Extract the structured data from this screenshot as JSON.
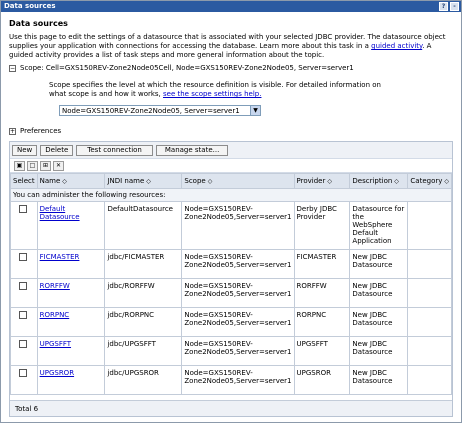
{
  "window": {
    "title": "Data sources",
    "buttons": [
      "?",
      "-"
    ]
  },
  "page": {
    "heading": "Data sources",
    "description": "Use this page to edit the settings of a datasource that is associated with your selected JDBC provider. The datasource object supplies your application with connections for accessing the database. Learn more about this task in a",
    "guided_link": "guided activity",
    "description_tail": ". A guided activity provides a list of task steps and more general information about the topic.",
    "scope_label": "Scope: Cell=GXS150REV-Zone2Node05Cell, Node=GXS150REV-Zone2Node05, Server=server1",
    "scope_desc": "Scope specifies the level at which the resource definition is visible. For detailed information on what scope is and how it works,",
    "scope_link": "see the scope settings help.",
    "scope_select": "Node=GXS150REV-Zone2Node05, Server=server1",
    "preferences": "Preferences"
  },
  "toolbar": {
    "new": "New",
    "delete": "Delete",
    "test": "Test connection",
    "manage": "Manage state..."
  },
  "table": {
    "headers": [
      "Select",
      "Name",
      "JNDI name",
      "Scope",
      "Provider",
      "Description",
      "Category"
    ],
    "admin_text": "You can administer the following resources:",
    "rows": [
      {
        "name": "Default Datasource",
        "jndi": "DefaultDatasource",
        "scope": "Node=GXS150REV-Zone2Node05,Server=server1",
        "provider": "Derby JDBC Provider",
        "description": "Datasource for the WebSphere Default Application",
        "category": ""
      },
      {
        "name": "FICMASTER",
        "jndi": "jdbc/FICMASTER",
        "scope": "Node=GXS150REV-Zone2Node05,Server=server1",
        "provider": "FICMASTER",
        "description": "New JDBC Datasource",
        "category": ""
      },
      {
        "name": "RORFFW",
        "jndi": "jdbc/RORFFW",
        "scope": "Node=GXS150REV-Zone2Node05,Server=server1",
        "provider": "RORFFW",
        "description": "New JDBC Datasource",
        "category": ""
      },
      {
        "name": "RORPNC",
        "jndi": "jdbc/RORPNC",
        "scope": "Node=GXS150REV-Zone2Node05,Server=server1",
        "provider": "RORPNC",
        "description": "New JDBC Datasource",
        "category": ""
      },
      {
        "name": "UPGSFFT",
        "jndi": "jdbc/UPGSFFT",
        "scope": "Node=GXS150REV-Zone2Node05,Server=server1",
        "provider": "UPGSFFT",
        "description": "New JDBC Datasource",
        "category": ""
      },
      {
        "name": "UPGSROR",
        "jndi": "jdbc/UPGSROR",
        "scope": "Node=GXS150REV-Zone2Node05,Server=server1",
        "provider": "UPGSROR",
        "description": "New JDBC Datasource",
        "category": ""
      }
    ],
    "total": "Total 6"
  }
}
